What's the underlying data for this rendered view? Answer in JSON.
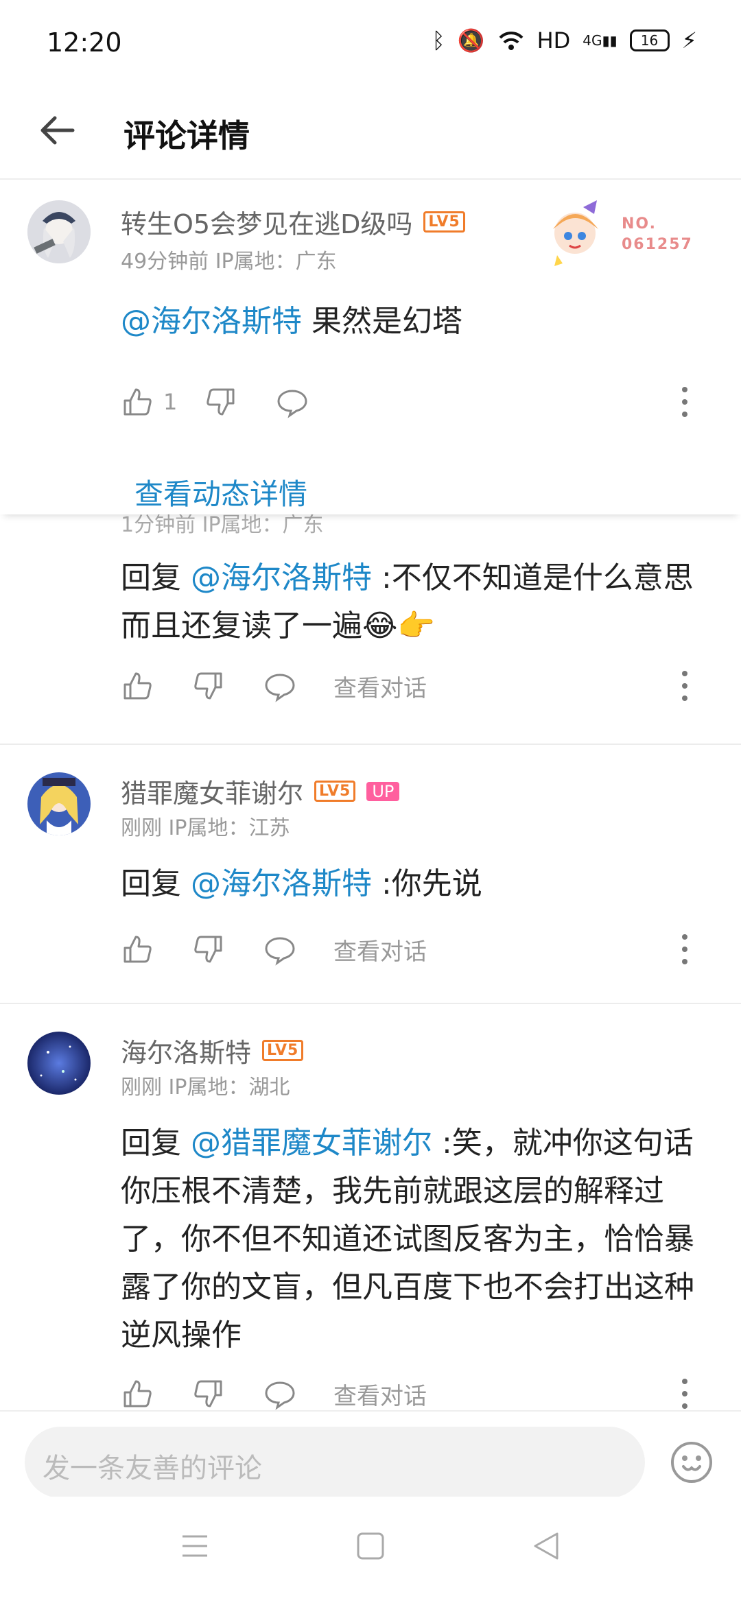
{
  "status_bar": {
    "time": "12:20",
    "network": "HD",
    "signal_type": "4G",
    "battery": "16"
  },
  "header": {
    "title": "评论详情"
  },
  "main_comment": {
    "username": "转生O5会梦见在逃D级吗",
    "level": "LV5",
    "meta": "49分钟前  IP属地：广东",
    "mention": "@海尔洛斯特",
    "text": " 果然是幻塔",
    "like_count": "1",
    "badge_label": "NO.",
    "badge_number": "061257",
    "detail_link": "查看动态详情"
  },
  "partial_reply": {
    "meta": "1分钟前  IP属地：广东",
    "prefix": "回复 ",
    "mention": "@海尔洛斯特",
    "text": " :不仅不知道是什么意思而且还复读了一遍😂👉",
    "view_conversation": "查看对话"
  },
  "reply_1": {
    "username": "猎罪魔女菲谢尔",
    "level": "LV5",
    "badge": "UP",
    "meta": "刚刚  IP属地：江苏",
    "prefix": "回复 ",
    "mention": "@海尔洛斯特",
    "text": " :你先说",
    "view_conversation": "查看对话"
  },
  "reply_2": {
    "username": "海尔洛斯特",
    "level": "LV5",
    "meta": "刚刚  IP属地：湖北",
    "prefix": "回复 ",
    "mention": "@猎罪魔女菲谢尔",
    "text": " :笑，就冲你这句话你压根不清楚，我先前就跟这层的解释过了，你不但不知道还试图反客为主，恰恰暴露了你的文盲，但凡百度下也不会打出这种逆风操作",
    "view_conversation": "查看对话"
  },
  "input_bar": {
    "placeholder": "发一条友善的评论"
  },
  "colors": {
    "link": "#1e88c8",
    "level": "#f07c2a",
    "up_badge": "#ff5f9e"
  },
  "icons": [
    "back-arrow-icon",
    "like-icon",
    "dislike-icon",
    "comment-icon",
    "more-icon",
    "emoji-icon",
    "menu-nav-icon",
    "home-nav-icon",
    "back-nav-icon"
  ]
}
